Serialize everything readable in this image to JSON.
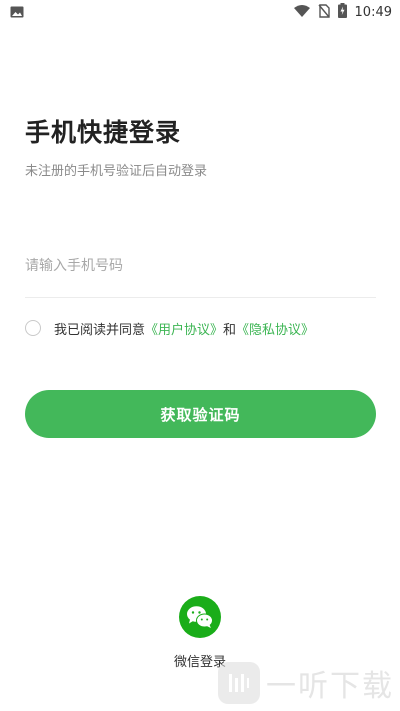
{
  "status_bar": {
    "time": "10:49",
    "icons": [
      "gallery-icon",
      "wifi-icon",
      "no-sim-icon",
      "battery-charging-icon"
    ]
  },
  "login": {
    "title": "手机快捷登录",
    "subtitle": "未注册的手机号验证后自动登录",
    "phone_placeholder": "请输入手机号码",
    "phone_value": ""
  },
  "agreement": {
    "prefix": "我已阅读并同意",
    "user_agreement": "《用户协议》",
    "and": "和",
    "privacy_policy": "《隐私协议》",
    "checked": false
  },
  "actions": {
    "get_code": "获取验证码",
    "wechat_login": "微信登录"
  },
  "watermark": {
    "text": "一听下载"
  },
  "colors": {
    "primary": "#43b85a",
    "link": "#3cb553",
    "wechat": "#1aad19"
  }
}
